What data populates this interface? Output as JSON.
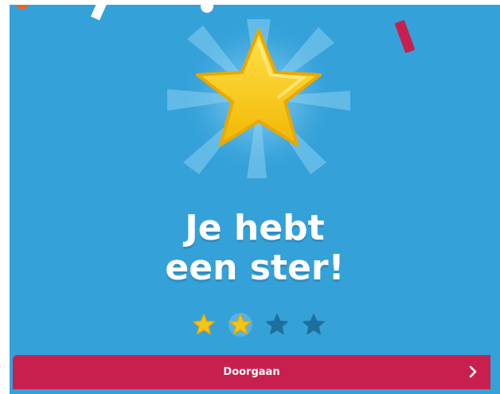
{
  "celebration": {
    "title_line1": "Je hebt",
    "title_line2": "een ster!"
  },
  "progress": {
    "earned": 2,
    "total": 4
  },
  "continue_button": {
    "label": "Doorgaan",
    "icon": "chevron-right-icon"
  },
  "icons": {
    "main": "star-icon"
  },
  "colors": {
    "background": "#35a1d9",
    "star_gold": "#f5c518",
    "star_empty": "#1e6f9d",
    "button": "#c8204e",
    "text": "#ffffff"
  }
}
